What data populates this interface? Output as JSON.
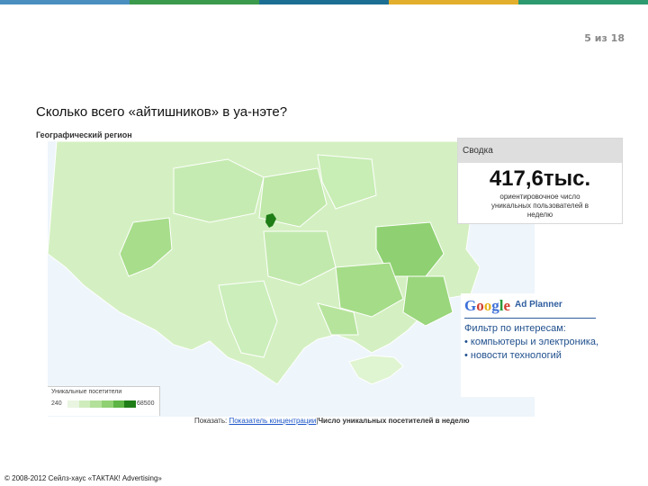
{
  "slide": {
    "page_number": "5 из 18",
    "title": "Сколько всего «айтишников» в уа-нэте?",
    "copyright": "© 2008-2012 Сейлз-хаус «ТАКТАК! Advertising»",
    "top_bar_colors": [
      "#4a8fbf",
      "#3b9a4c",
      "#1c6f93",
      "#e3ae2b",
      "#2d9a6f"
    ]
  },
  "map": {
    "label": "Географический регион",
    "water_color": "#eef5fb",
    "legend": {
      "title": "Уникальные посетители",
      "min": "240",
      "max": "68500",
      "colors": [
        "#e9f5e0",
        "#cfecbd",
        "#b3e09a",
        "#8fd172",
        "#5cb544",
        "#1e7d16"
      ]
    }
  },
  "summary": {
    "header": "Сводка",
    "value": "417,6тыс.",
    "description": "ориентировочное число уникальных пользователей в неделю"
  },
  "ad_planner": {
    "logo_letters": [
      "G",
      "o",
      "o",
      "g",
      "l",
      "e"
    ],
    "logo_colors": [
      "#3d6fd8",
      "#d13e2f",
      "#e8b21c",
      "#3d6fd8",
      "#2b9b3a",
      "#d13e2f"
    ],
    "product": "Ad Planner",
    "filter_title": "Фильтр по интересам:",
    "items": [
      "• компьютеры и электроника,",
      "• новости технологий"
    ]
  },
  "footer_links": {
    "show_label": "Показать:",
    "link": "Показатель концентрации",
    "separator": "|",
    "bold_label": "Число уникальных посетителей в неделю"
  }
}
